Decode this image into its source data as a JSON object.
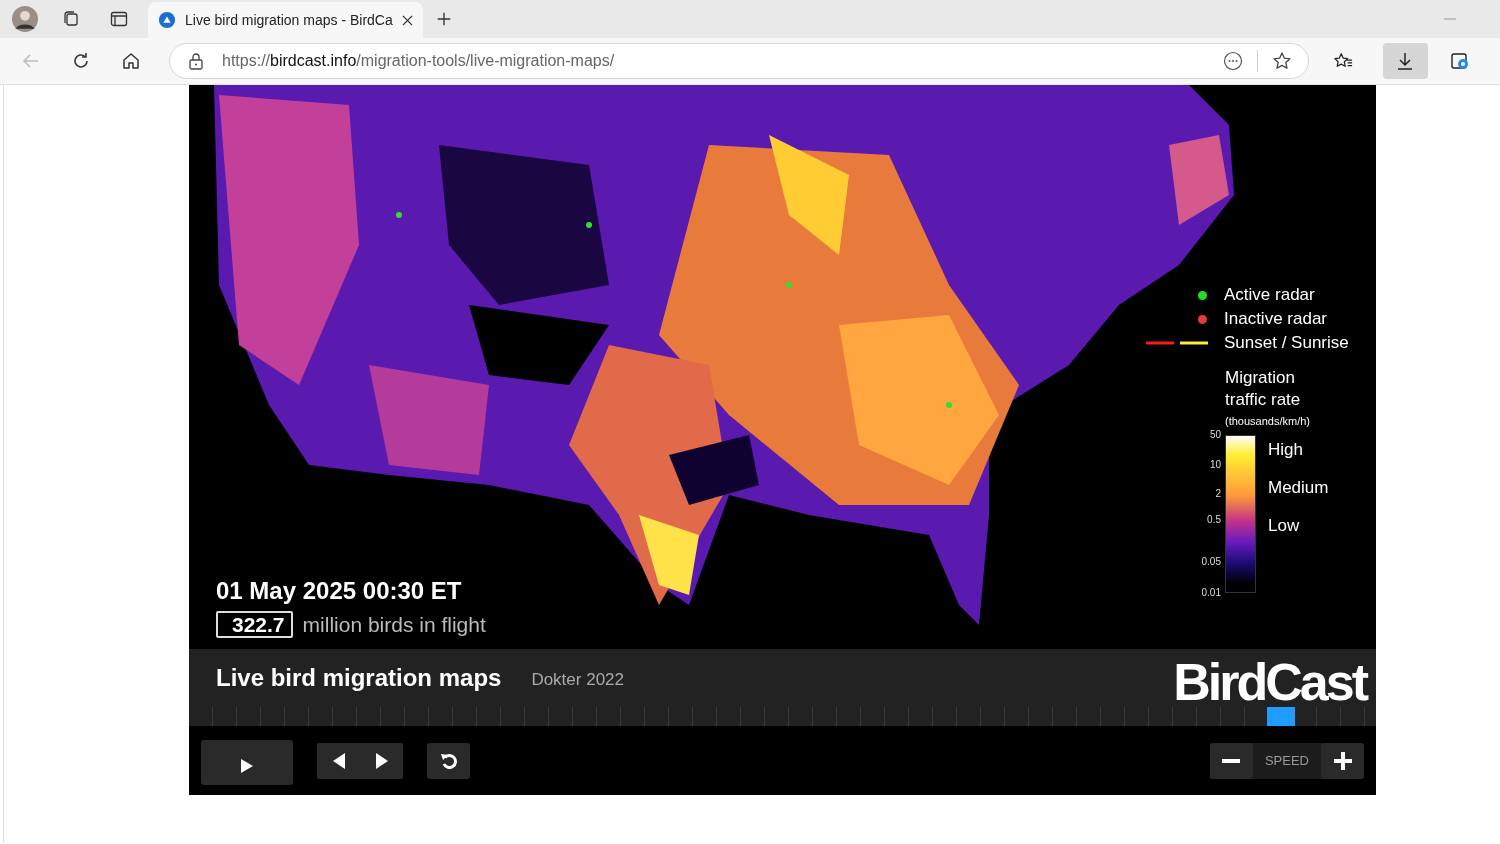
{
  "browser": {
    "tabs": [
      {
        "title": "Live bird migration maps - BirdCa",
        "selected": true
      }
    ],
    "address": "https://**birdcast.info**/migration-tools/live-migration-maps/"
  },
  "map": {
    "kind": "picture",
    "legend": {
      "markers": [
        {
          "label": "Active radar",
          "color": "#22dd22"
        },
        {
          "label": "Inactive radar",
          "color": "#e03c3c"
        }
      ],
      "line_label": "Sunset / Sunrise",
      "scale_title": "Migration traffic rate",
      "scale_unit": "(thousands/km/h)",
      "ticks": [
        "50",
        "10",
        "2",
        "0.5",
        "0.05",
        "0.01"
      ],
      "levels": [
        "High",
        "Medium",
        "Low"
      ]
    },
    "datetime": "01 May 2025 00:30 ET",
    "count": "322.7",
    "count_label": "million birds in flight"
  },
  "caption": {
    "title": "Live bird migration maps",
    "credit": "Dokter 2022",
    "logo": "BirdCast"
  },
  "timeline": {
    "level": 0.92
  },
  "controls": {
    "speed_label": "SPEED"
  }
}
